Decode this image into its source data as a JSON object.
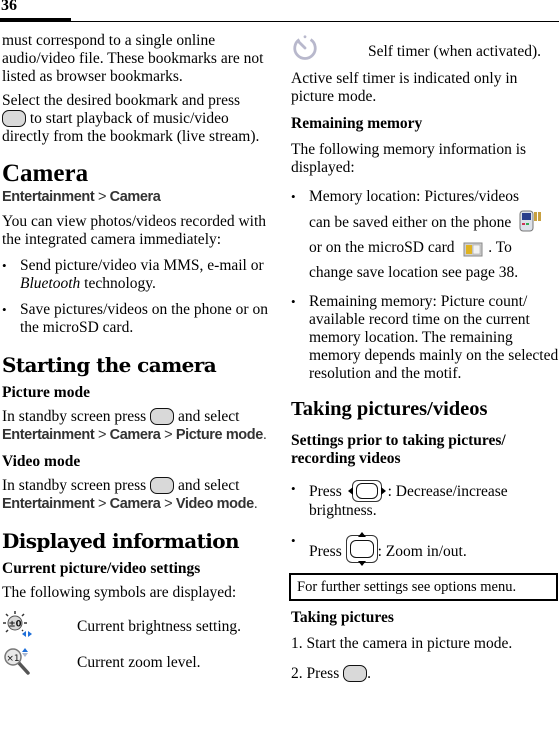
{
  "header": {
    "page_number": "36"
  },
  "left": {
    "intro_para1": "must correspond to a single online audio/video file. These bookmarks are not listed as browser bookmarks.",
    "intro_para2_pre": "Select the desired bookmark and press",
    "intro_para2_post": "to start playback of music/video directly from the bookmark (live stream).",
    "camera_heading": "Camera",
    "camera_path": {
      "a": "Entertainment",
      "sep": ">",
      "b": "Camera"
    },
    "camera_para": "You can view photos/videos recorded with the integrated camera immediately:",
    "camera_bullets": {
      "b1_pre": "Send picture/video via MMS, e-mail or",
      "b1_italic": "Bluetooth",
      "b1_post": "technology.",
      "b2": "Save pictures/videos on the phone or on the microSD card."
    },
    "starting_heading": "Starting the camera",
    "picture_mode": {
      "heading": "Picture mode",
      "text_pre": "In standby screen press",
      "text_post": "and select",
      "path": [
        "Entertainment",
        "Camera",
        "Picture mode"
      ],
      "sep": ">"
    },
    "video_mode": {
      "heading": "Video mode",
      "text_pre": "In standby screen press",
      "text_post": "and select",
      "path": [
        "Entertainment",
        "Camera",
        "Video mode"
      ],
      "sep": ">"
    },
    "displayed_heading": "Displayed information",
    "current_settings_heading": "Current picture/video settings",
    "symbols_intro": "The following symbols are displayed:",
    "symbols": [
      {
        "icon": "brightness-icon",
        "label": "±0",
        "text": "Current brightness setting."
      },
      {
        "icon": "zoom-icon",
        "label": "×1",
        "text": "Current zoom level."
      }
    ]
  },
  "right": {
    "self_timer": {
      "icon": "self-timer-icon",
      "text": "Self timer (when activated)."
    },
    "self_timer_note": "Active self timer is indicated only in picture mode.",
    "remaining_heading": "Remaining memory",
    "remaining_intro": "The following memory information is displayed:",
    "memory_bullets": {
      "b1_line1": "Memory location: Pictures/videos",
      "b1_line2": "can be saved either on the phone",
      "b1_line3": "or on the microSD card",
      "b1_line4_pre": ". To",
      "b1_line5": "change save location see page 38.",
      "b2": "Remaining memory: Picture count/ available record time on the current memory location. The remaining memory depends mainly on the selected resolution and the motif."
    },
    "taking_heading": "Taking pictures/videos",
    "settings_heading": "Settings prior to taking pictures/ recording videos",
    "settings_bullets": {
      "b1_pre": "Press",
      "b1_post": ": Decrease/increase brightness.",
      "b2_pre": "Press",
      "b2_post": ": Zoom in/out."
    },
    "note_box": "For further settings see options menu.",
    "taking_pictures_heading": "Taking pictures",
    "steps": {
      "s1": "1. Start the camera in picture mode.",
      "s2_pre": "2. Press",
      "s2_post": "."
    }
  }
}
